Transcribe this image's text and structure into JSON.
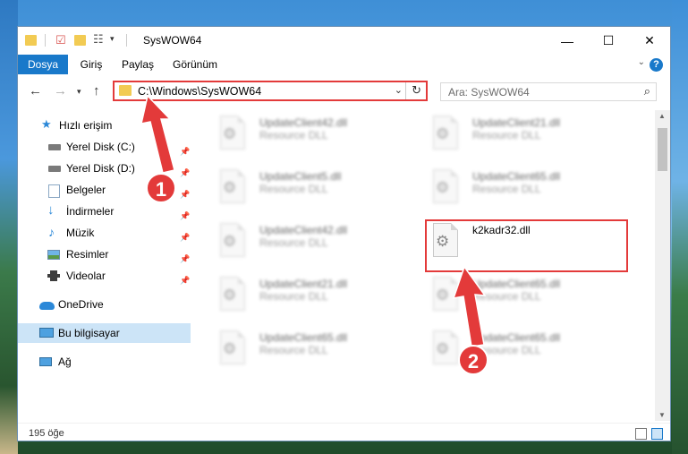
{
  "window": {
    "title": "SysWOW64",
    "controls": {
      "minimize": "—",
      "maximize": "☐",
      "close": "✕"
    }
  },
  "ribbon": {
    "tabs": [
      {
        "label": "Dosya",
        "active": true
      },
      {
        "label": "Giriş"
      },
      {
        "label": "Paylaş"
      },
      {
        "label": "Görünüm"
      }
    ],
    "help": "?"
  },
  "address": {
    "path": "C:\\Windows\\SysWOW64",
    "search_placeholder": "Ara: SysWOW64"
  },
  "sidebar": {
    "items": [
      {
        "label": "Hızlı erişim",
        "icon": "star-icon"
      },
      {
        "label": "Yerel Disk (C:)",
        "icon": "drive-icon",
        "pinned": true
      },
      {
        "label": "Yerel Disk (D:)",
        "icon": "drive-icon",
        "pinned": true
      },
      {
        "label": "Belgeler",
        "icon": "documents-icon",
        "pinned": true
      },
      {
        "label": "İndirmeler",
        "icon": "download-icon",
        "pinned": true
      },
      {
        "label": "Müzik",
        "icon": "music-icon",
        "pinned": true
      },
      {
        "label": "Resimler",
        "icon": "pictures-icon",
        "pinned": true
      },
      {
        "label": "Videolar",
        "icon": "videos-icon",
        "pinned": true
      },
      {
        "label": "OneDrive",
        "icon": "onedrive-icon"
      },
      {
        "label": "Bu bilgisayar",
        "icon": "computer-icon",
        "selected": true
      },
      {
        "label": "Ağ",
        "icon": "network-icon"
      }
    ]
  },
  "files": [
    {
      "name": "UpdateClient42.dll",
      "type": "Resource DLL"
    },
    {
      "name": "UpdateClient21.dll",
      "type": "Resource DLL"
    },
    {
      "name": "UpdateClient5.dll",
      "type": "Resource DLL"
    },
    {
      "name": "UpdateClient65.dll",
      "type": "Resource DLL"
    },
    {
      "name": "UpdateClient42.dll",
      "type": "Resource DLL"
    },
    {
      "name": "k2kadr32.dll",
      "type": ""
    },
    {
      "name": "UpdateClient21.dll",
      "type": "Resource DLL"
    },
    {
      "name": "UpdateClient65.dll",
      "type": "Resource DLL"
    },
    {
      "name": "UpdateClient65.dll",
      "type": "Resource DLL"
    },
    {
      "name": "UpdateClient65.dll",
      "type": "Resource DLL"
    }
  ],
  "status": {
    "count": "195 öğe"
  },
  "annotations": {
    "step1": "1",
    "step2": "2",
    "color": "#e33a3a"
  }
}
